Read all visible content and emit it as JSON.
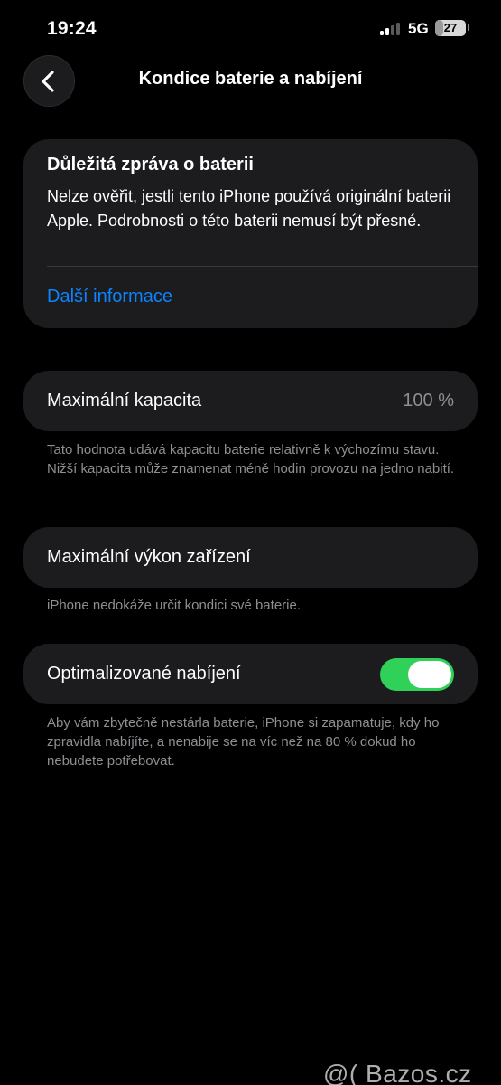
{
  "status_bar": {
    "time": "19:24",
    "network": "5G",
    "battery_percent": "27",
    "battery_level": 0.27,
    "icons": [
      "signal-icon",
      "battery-icon"
    ]
  },
  "nav": {
    "title": "Kondice baterie a nabíjení",
    "back_icon": "chevron-left-icon"
  },
  "notice": {
    "title": "Důležitá zpráva o baterii",
    "body": "Nelze ověřit, jestli tento iPhone používá originální baterii Apple. Podrobnosti o této baterii nemusí být přesné.",
    "link": "Další informace"
  },
  "capacity": {
    "label": "Maximální kapacita",
    "value": "100 %",
    "footnote": "Tato hodnota udává kapacitu baterie relativně k výchozímu stavu. Nižší kapacita může znamenat méně hodin provozu na jedno nabití."
  },
  "performance": {
    "label": "Maximální výkon zařízení",
    "footnote": "iPhone nedokáže určit kondici své baterie."
  },
  "charging": {
    "label": "Optimalizované nabíjení",
    "enabled": true,
    "footnote": "Aby vám zbytečně nestárla baterie, iPhone si zapamatuje, kdy ho zpravidla nabíjíte, a nenabije se na víc než na 80 % dokud ho nebudete potřebovat."
  },
  "watermark": "@( Bazos.cz",
  "colors": {
    "background": "#000000",
    "card": "#1c1c1e",
    "link": "#0a84ff",
    "toggle_on": "#30d158",
    "secondary_text": "#8e8e93"
  }
}
